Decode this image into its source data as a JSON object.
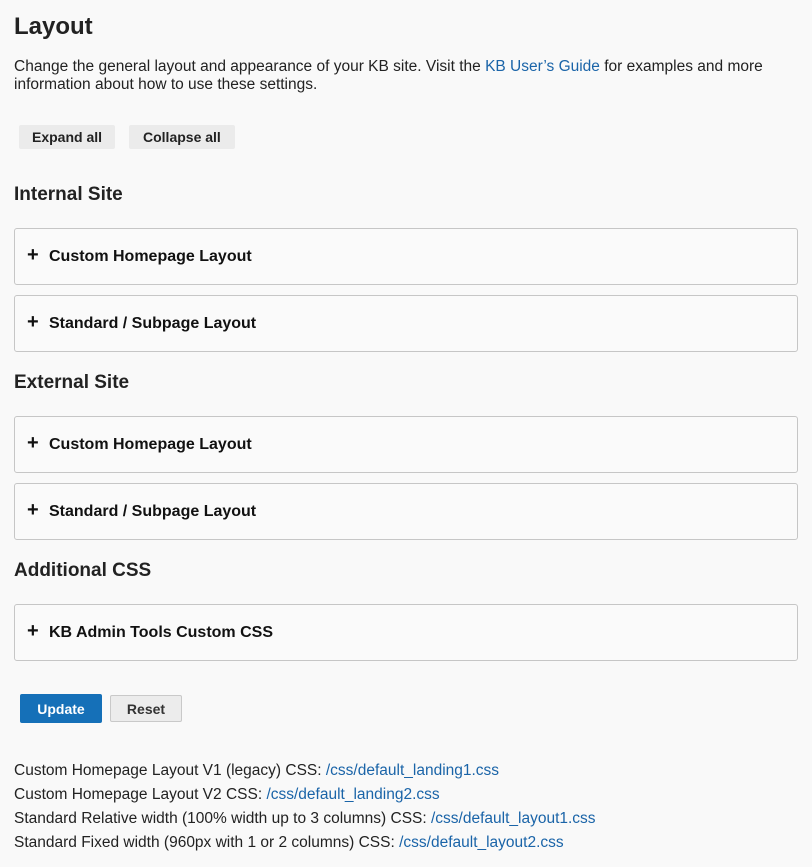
{
  "page": {
    "title": "Layout",
    "intro_before": "Change the general layout and appearance of your KB site. Visit the ",
    "intro_link": "KB User’s Guide",
    "intro_after": " for examples and more information about how to use these settings."
  },
  "toolbar": {
    "expand_all": "Expand all",
    "collapse_all": "Collapse all"
  },
  "sections": {
    "internal": {
      "title": "Internal Site",
      "panels": [
        "Custom Homepage Layout",
        "Standard / Subpage Layout"
      ]
    },
    "external": {
      "title": "External Site",
      "panels": [
        "Custom Homepage Layout",
        "Standard / Subpage Layout"
      ]
    },
    "additional": {
      "title": "Additional CSS",
      "panels": [
        "KB Admin Tools Custom CSS"
      ]
    }
  },
  "panel_icon": "plus-icon",
  "actions": {
    "update": "Update",
    "reset": "Reset"
  },
  "css_files": [
    {
      "label": "Custom Homepage Layout V1 (legacy) CSS: ",
      "path": "/css/default_landing1.css"
    },
    {
      "label": "Custom Homepage Layout V2 CSS: ",
      "path": "/css/default_landing2.css"
    },
    {
      "label": "Standard Relative width (100% width up to 3 columns) CSS: ",
      "path": "/css/default_layout1.css"
    },
    {
      "label": "Standard Fixed width (960px with 1 or 2 columns) CSS: ",
      "path": "/css/default_layout2.css"
    }
  ],
  "colors": {
    "link": "#1a64a8",
    "primary_button": "#1570b8",
    "background": "#f9f9f9",
    "panel_border": "#c6c6c6"
  }
}
